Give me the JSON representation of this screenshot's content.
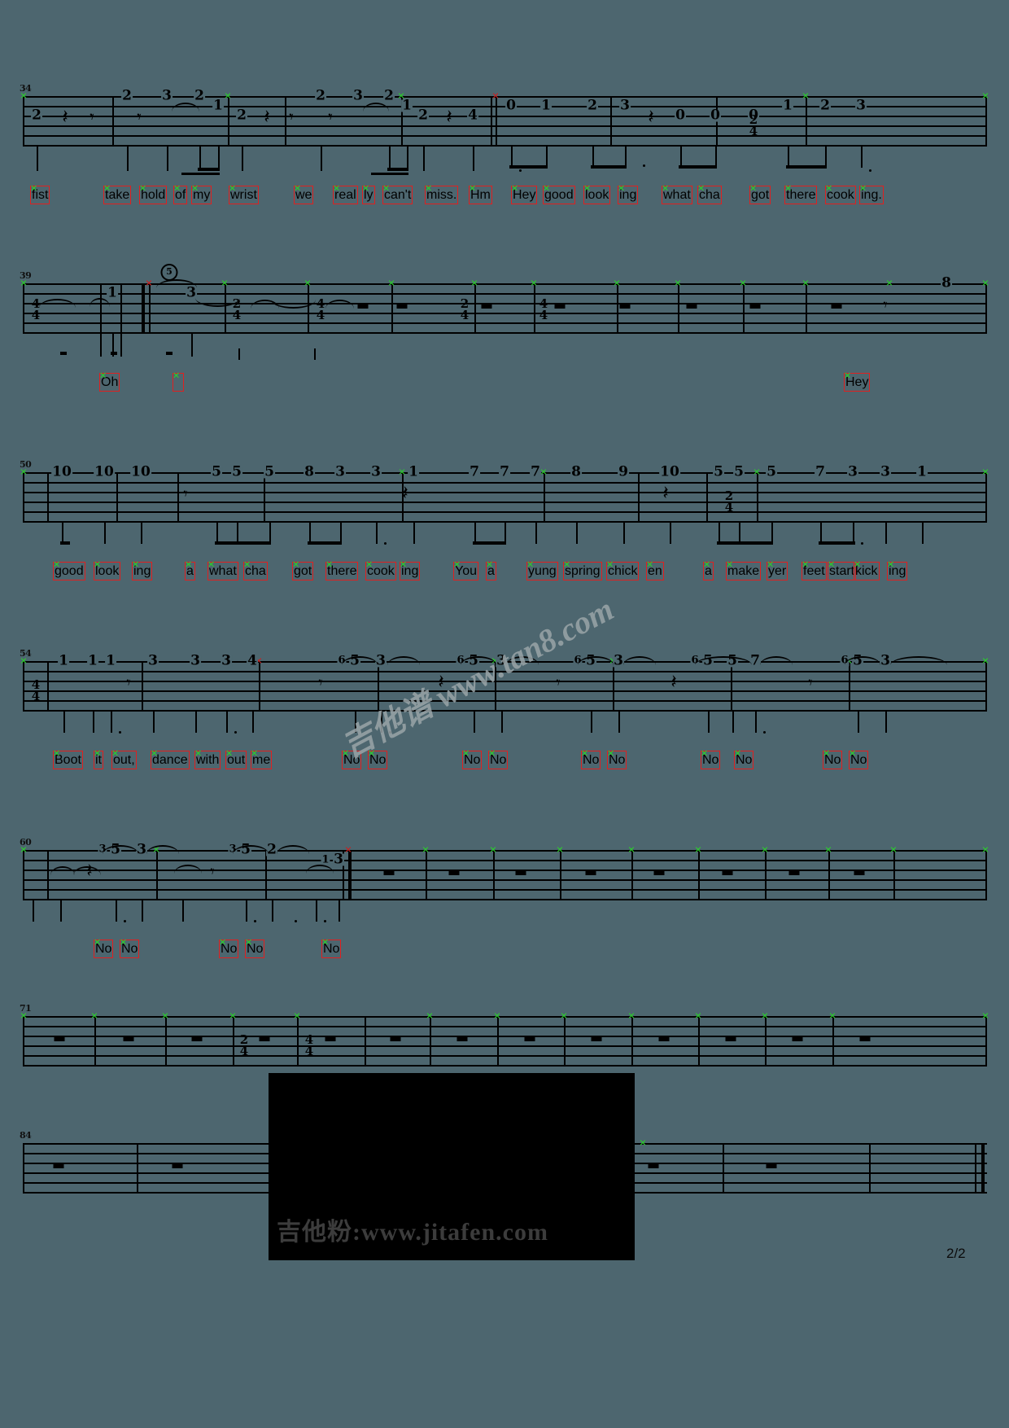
{
  "document": {
    "kind": "guitar-tablature",
    "page_label": "2/2",
    "background_color": "#4d666f",
    "ink_color": "#000000",
    "lyric_box_color": "#e02020",
    "anchor_marker_color": "#2ad12a"
  },
  "watermarks": {
    "diagonal": "吉他谱 www.tan8.com",
    "bottom": "吉他粉:www.jitafen.com"
  },
  "systems": [
    {
      "id": "system-1",
      "measure_number": "34",
      "time_signatures": [
        "2/4"
      ],
      "tab_numbers": [
        "2",
        "2",
        "3",
        "2",
        "1",
        "2",
        "2",
        "3",
        "2",
        "1",
        "2",
        "4",
        "0",
        "1",
        "2",
        "3",
        "0",
        "0",
        "0",
        "1",
        "2",
        "3"
      ],
      "lyrics": [
        "fist",
        "take",
        "hold",
        "of",
        "my",
        "wrist",
        "we",
        "real",
        "ly",
        "can't",
        "miss.",
        "Hm",
        "Hey",
        "good",
        "look",
        "ing",
        "what",
        "cha",
        "got",
        "there",
        "cook",
        "ing."
      ]
    },
    {
      "id": "system-2",
      "measure_number": "39",
      "time_signatures": [
        "4/4",
        "2/4",
        "4/4",
        "2/4",
        "4/4"
      ],
      "tab_numbers": [
        "1",
        "3",
        "8"
      ],
      "repeat_marker": "5",
      "lyrics": [
        "Oh",
        "",
        "Hey"
      ]
    },
    {
      "id": "system-3",
      "measure_number": "50",
      "time_signatures": [
        "2/4"
      ],
      "tab_numbers": [
        "10",
        "10",
        "10",
        "5",
        "5",
        "5",
        "8",
        "3",
        "3",
        "1",
        "7",
        "7",
        "7",
        "8",
        "9",
        "10",
        "5",
        "5",
        "5",
        "7",
        "3",
        "3",
        "1"
      ],
      "lyrics": [
        "good",
        "look",
        "ing",
        "a",
        "what",
        "cha",
        "got",
        "there",
        "cook",
        "ing",
        "You",
        "a",
        "yung",
        "spring",
        "chick",
        "en",
        "a",
        "make",
        "yer",
        "feet",
        "start",
        "kick",
        "ing"
      ]
    },
    {
      "id": "system-4",
      "measure_number": "54",
      "time_signatures": [
        "4/4"
      ],
      "tab_numbers": [
        "1",
        "1",
        "1",
        "3",
        "3",
        "3",
        "4",
        "6",
        "5",
        "3",
        "6",
        "5",
        "3",
        "6",
        "5",
        "3",
        "6",
        "5",
        "5",
        "7",
        "6",
        "5",
        "3"
      ],
      "lyrics": [
        "Boot",
        "it",
        "out,",
        "dance",
        "with",
        "out",
        "me",
        "No",
        "No",
        "No",
        "No",
        "No",
        "No",
        "No",
        "No",
        "No",
        "No"
      ]
    },
    {
      "id": "system-5",
      "measure_number": "60",
      "time_signatures": [],
      "tab_numbers": [
        "3",
        "5",
        "3",
        "3",
        "5",
        "2",
        "1",
        "3"
      ],
      "lyrics": [
        "No",
        "No",
        "No",
        "No",
        "No"
      ]
    },
    {
      "id": "system-6",
      "measure_number": "71",
      "time_signatures": [
        "2/4",
        "4/4"
      ],
      "tab_numbers": [],
      "lyrics": []
    },
    {
      "id": "system-7",
      "measure_number": "84",
      "time_signatures": [],
      "tab_numbers": [],
      "lyrics": []
    }
  ]
}
